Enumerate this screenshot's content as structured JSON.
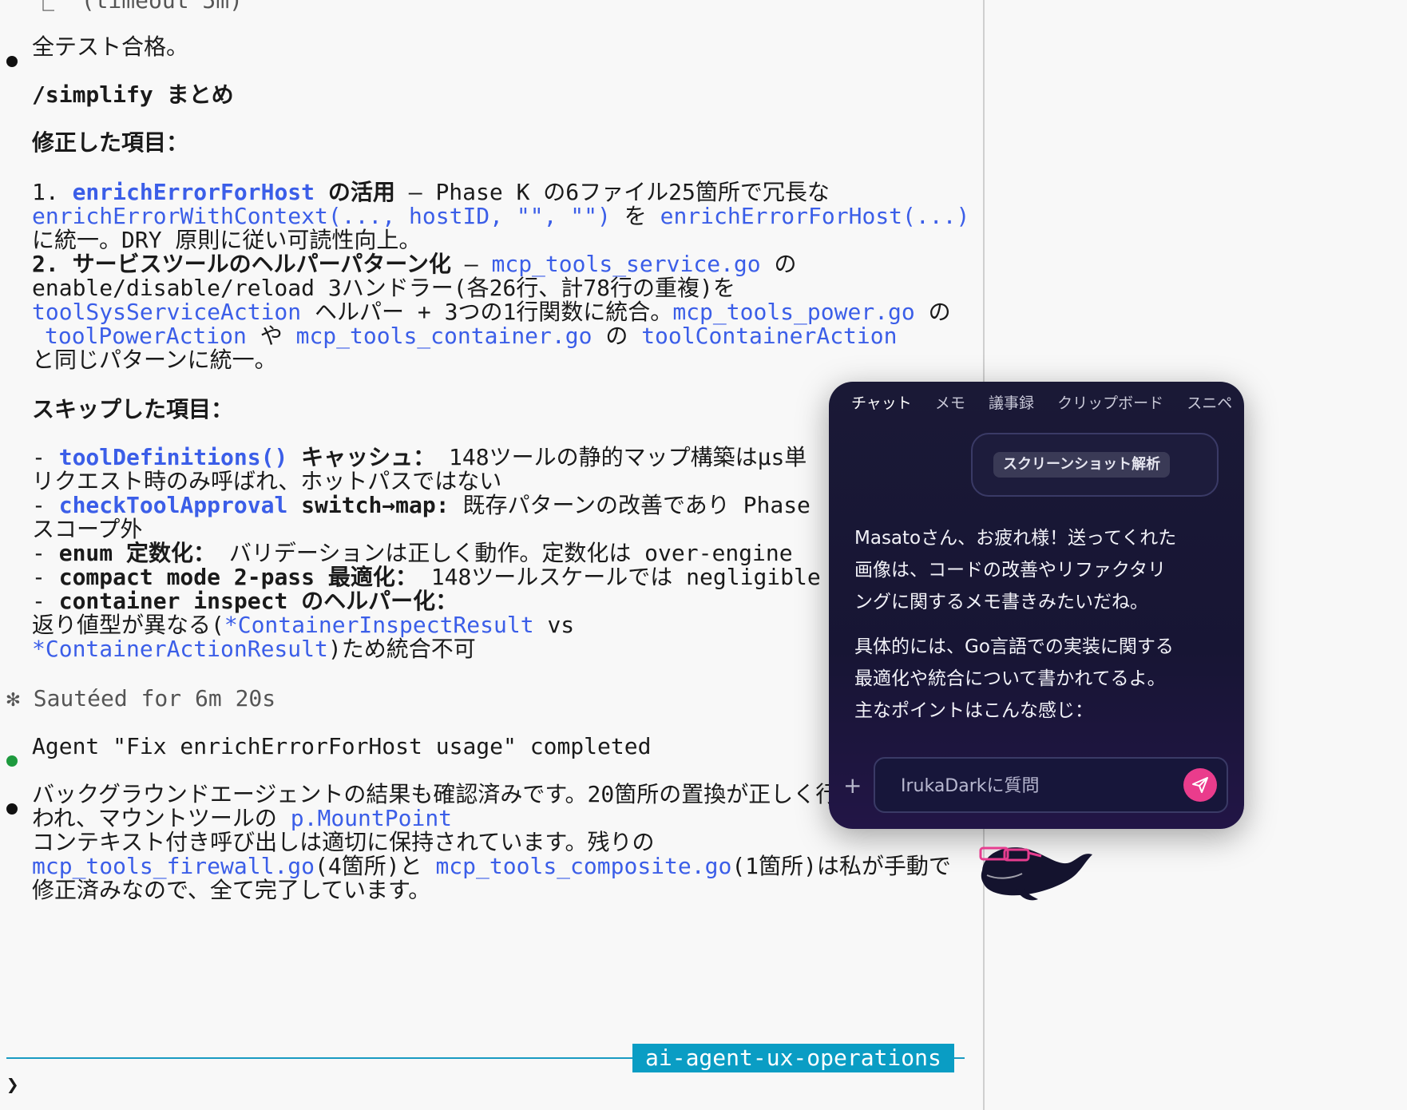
{
  "terminal": {
    "top_partial": "⎿  (timeout 5m)",
    "pass_msg": "全テスト合格。",
    "simplify_title": "/simplify まとめ",
    "fixed_heading": "修正した項目：",
    "item1": {
      "num": "1. ",
      "fn": "enrichErrorForHost",
      "title_suffix": " の活用",
      "text1": " — Phase K の6ファイル25箇所で冗長な",
      "code1": "enrichErrorWithContext(..., hostID, \"\", \"\")",
      "mid": " を ",
      "code2": "enrichErrorForHost(...)",
      "text2": "に統一。DRY 原則に従い可読性向上。"
    },
    "item2": {
      "num": "2. ",
      "title": "サービスツールのヘルパーパターン化",
      "dash": " — ",
      "file1": "mcp_tools_service.go",
      "no1": " の",
      "text1": "enable/disable/reload 3ハンドラー(各26行、計78行の重複)を",
      "helper": "toolSysServiceAction",
      "text2": " ヘルパー + 3つの1行関数に統合。",
      "file2": "mcp_tools_power.go",
      "no2": " の",
      "fn3": "toolPowerAction",
      "ya": " や ",
      "file3": "mcp_tools_container.go",
      "no3": " の ",
      "fn4": "toolContainerAction",
      "text3": "と同じパターンに統一。"
    },
    "skipped_heading": "スキップした項目：",
    "skip1": {
      "dash": "- ",
      "fn": "toolDefinitions()",
      "label": " キャッシュ：",
      "text": " 148ツールの静的マップ構築はμs単",
      "text2": "リクエスト時のみ呼ばれ、ホットパスではない"
    },
    "skip2": {
      "dash": "- ",
      "fn": "checkToolApproval",
      "label": " switch→map:",
      "text": " 既存パターンの改善であり Phase",
      "text2": "スコープ外"
    },
    "skip3": {
      "dash": "- ",
      "label": "enum 定数化：",
      "text": " バリデーションは正しく動作。定数化は over-engine"
    },
    "skip4": {
      "dash": "- ",
      "label": "compact mode 2-pass 最適化：",
      "text": " 148ツールスケールでは negligible"
    },
    "skip5": {
      "dash": "- ",
      "label": "container inspect のヘルパー化：",
      "text_pre": "返り値型が異なる(",
      "type1": "*ContainerInspectResult",
      "vs": " vs",
      "type2": "*ContainerActionResult",
      "text_post": ")ため統合不可"
    },
    "sauteed": "✻ Sautéed for 6m 20s",
    "agent_done": "Agent \"Fix enrichErrorForHost usage\" completed",
    "bg": {
      "t1": "バックグラウンドエージェントの結果も確認済みです。20箇所の置換が正しく行",
      "t2": "われ、マウントツールの ",
      "code1": "p.MountPoint",
      "t3": "コンテキスト付き呼び出しは適切に保持されています。残りの",
      "file1": "mcp_tools_firewall.go",
      "t4": "(4箇所)と ",
      "file2": "mcp_tools_composite.go",
      "t5": "(1箇所)は私が手動で",
      "t6": "修正済みなので、全て完了しています。"
    },
    "branch": "ai-agent-ux-operations",
    "prompt": "❯"
  },
  "chat": {
    "tabs": [
      "チャット",
      "メモ",
      "議事録",
      "クリップボード",
      "スニペ"
    ],
    "chip": "スクリーンショット解析",
    "msg1_lines": [
      "Masatoさん、お疲れ様！送ってくれた",
      "画像は、コードの改善やリファクタリ",
      "ングに関するメモ書きみたいだね。"
    ],
    "msg2_lines": [
      "具体的には、Go言語での実装に関する",
      "最適化や統合について書かれてるよ。",
      "主なポイントはこんな感じ："
    ],
    "plus": "+",
    "input_placeholder": "IrukaDarkに質問",
    "accent": "#ea3c8c"
  }
}
